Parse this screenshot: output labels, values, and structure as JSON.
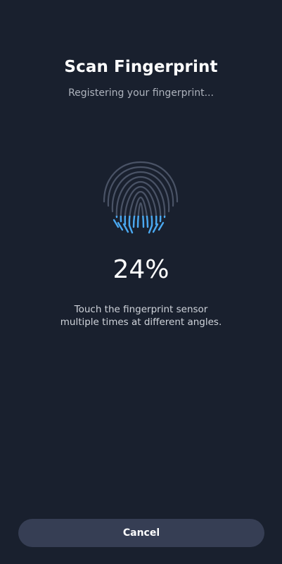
{
  "header": {
    "title": "Scan Fingerprint",
    "subtitle": "Registering your fingerprint..."
  },
  "scan": {
    "icon": "fingerprint-icon",
    "progress_percent": 24,
    "progress_label": "24%",
    "instruction_line1": "Touch the fingerprint sensor",
    "instruction_line2": "multiple times at different angles."
  },
  "footer": {
    "cancel_label": "Cancel"
  },
  "colors": {
    "background": "#19202e",
    "ridge_inactive": "#4a5366",
    "ridge_active": "#4aa8f0",
    "button_bg": "#363e54"
  }
}
